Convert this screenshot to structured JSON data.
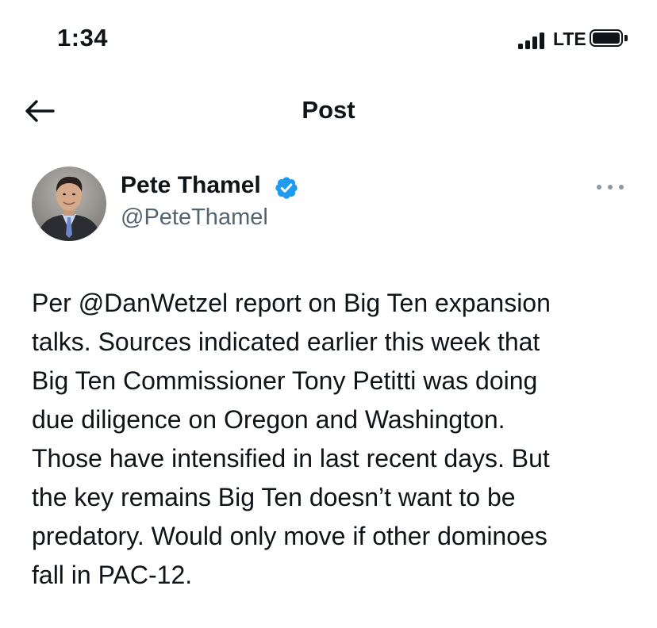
{
  "status_bar": {
    "time": "1:34",
    "network": "LTE",
    "signal_icon": "cellular-signal-icon",
    "battery_icon": "battery-icon"
  },
  "header": {
    "title": "Post",
    "back_icon": "back-arrow-icon"
  },
  "author": {
    "name": "Pete Thamel",
    "handle": "@PeteThamel",
    "verified": true,
    "verified_color": "#1d9bf0",
    "more_icon": "more-options-icon"
  },
  "tweet": {
    "lines": [
      "Per @DanWetzel report on Big Ten expansion",
      "talks. Sources indicated earlier this week that",
      "Big Ten Commissioner Tony Petitti was doing",
      "due diligence on Oregon and Washington.",
      "Those have intensified in last recent days. But",
      "the key remains Big Ten doesn’t want to be",
      "predatory. Would only move if other dominoes",
      "fall in PAC-12."
    ]
  },
  "colors": {
    "text": "#0f1419",
    "secondary": "#536471",
    "accent": "#1d9bf0"
  }
}
